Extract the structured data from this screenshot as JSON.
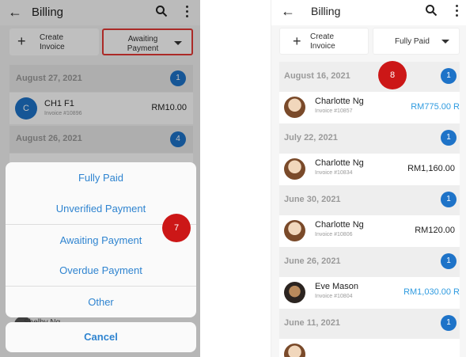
{
  "left_screen": {
    "app_title": "Billing",
    "filters": {
      "create": "Create\nInvoice",
      "create_l1": "Create",
      "create_l2": "Invoice",
      "status_l1": "Awaiting",
      "status_l2": "Payment"
    },
    "groups": [
      {
        "date": "August 27, 2021",
        "count": "1"
      },
      {
        "date": "August 26, 2021",
        "count": "4"
      }
    ],
    "row": {
      "avatar_letter": "C",
      "name": "CH1 F1",
      "invoice": "Invoice #10896",
      "amount": "RM10.00"
    },
    "peek_name": "Shelby Ng",
    "options": [
      "Fully Paid",
      "Unverified Payment",
      "Awaiting Payment",
      "Overdue Payment",
      "Other"
    ],
    "cancel": "Cancel",
    "step_marker": "7"
  },
  "right_screen": {
    "app_title": "Billing",
    "filters": {
      "create_l1": "Create",
      "create_l2": "Invoice",
      "status": "Fully Paid"
    },
    "step_marker": "8",
    "groups": [
      {
        "date": "August 16, 2021",
        "count": "1",
        "name": "Charlotte Ng",
        "invoice": "Invoice #10857",
        "amount": "RM775.00 R",
        "amount_color": "#2f9be0"
      },
      {
        "date": "July 22, 2021",
        "count": "1",
        "name": "Charlotte Ng",
        "invoice": "Invoice #10834",
        "amount": "RM1,160.00",
        "amount_color": "#222222"
      },
      {
        "date": "June 30, 2021",
        "count": "1",
        "name": "Charlotte Ng",
        "invoice": "Invoice #10806",
        "amount": "RM120.00",
        "amount_color": "#222222"
      },
      {
        "date": "June 26, 2021",
        "count": "1",
        "name": "Eve Mason",
        "invoice": "Invoice #10804",
        "amount": "RM1,030.00 R",
        "amount_color": "#2f9be0"
      },
      {
        "date": "June 11, 2021",
        "count": "1"
      }
    ]
  },
  "colors": {
    "accent": "#1e73c8",
    "link": "#2f84d0",
    "marker": "#cc1717",
    "highlight": "#e53935"
  }
}
